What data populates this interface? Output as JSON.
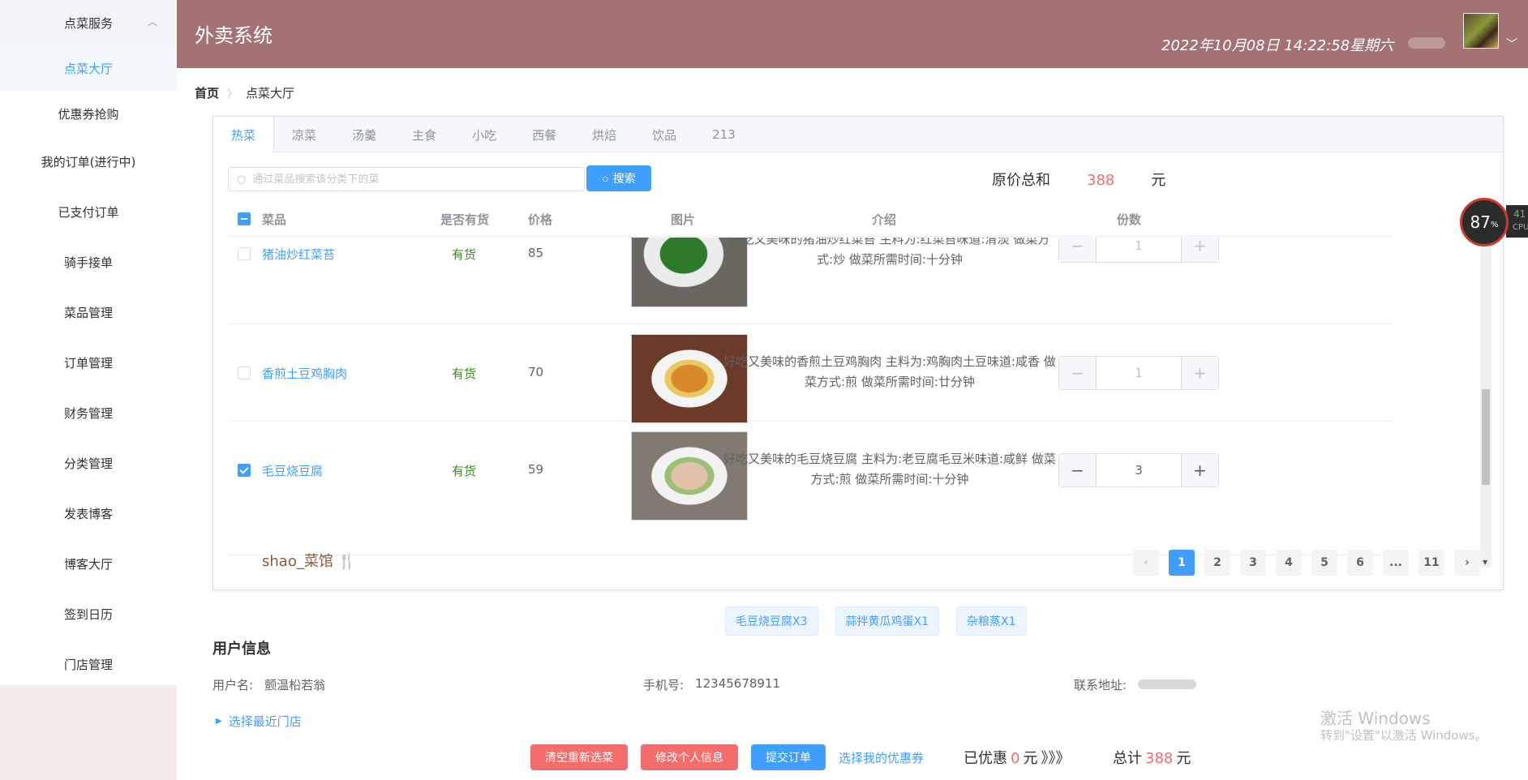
{
  "sidebar": {
    "group_label": "点菜服务",
    "subitems": [
      "点菜大厅",
      "优惠券抢购"
    ],
    "items": [
      "我的订单(进行中)",
      "已支付订单",
      "骑手接单",
      "菜品管理",
      "订单管理",
      "财务管理",
      "分类管理",
      "发表博客",
      "博客大厅",
      "签到日历",
      "门店管理"
    ]
  },
  "header": {
    "title": "外卖系统",
    "datetime": "2022年10月08日 14:22:58星期六"
  },
  "breadcrumb": {
    "home": "首页",
    "current": "点菜大厅"
  },
  "tabs": [
    "热菜",
    "凉菜",
    "汤羹",
    "主食",
    "小吃",
    "西餐",
    "烘焙",
    "饮品",
    "213"
  ],
  "search": {
    "placeholder": "通过菜品搜索该分类下的菜",
    "button": "搜索"
  },
  "summary": {
    "label": "原价总和",
    "amount": "388",
    "unit": "元"
  },
  "table": {
    "columns": [
      "菜品",
      "是否有货",
      "价格",
      "图片",
      "介绍",
      "份数"
    ],
    "rows": [
      {
        "name": "猪油炒红菜苔",
        "stock": "有货",
        "price": "85",
        "intro_line1": "好吃又美味的猪油炒红菜苔 主料为:红菜苔味道:清淡 做菜方",
        "intro_line2": "式:炒 做菜所需时间:十分钟",
        "qty": "1",
        "checked": false
      },
      {
        "name": "香煎土豆鸡胸肉",
        "stock": "有货",
        "price": "70",
        "intro_line1": "好吃又美味的香煎土豆鸡胸肉 主料为:鸡胸肉土豆味道:咸香 做",
        "intro_line2": "菜方式:煎 做菜所需时间:廿分钟",
        "qty": "1",
        "checked": false
      },
      {
        "name": "毛豆烧豆腐",
        "stock": "有货",
        "price": "59",
        "intro_line1": "好吃又美味的毛豆烧豆腐 主料为:老豆腐毛豆米味道:咸鲜 做菜",
        "intro_line2": "方式:煎 做菜所需时间:十分钟",
        "qty": "3",
        "checked": true
      }
    ]
  },
  "shop_name": "shao_菜馆",
  "pagination": {
    "pages": [
      "1",
      "2",
      "3",
      "4",
      "5",
      "6",
      "...",
      "11"
    ],
    "current": "1"
  },
  "chips": [
    "毛豆烧豆腐X3",
    "蒜拌黄瓜鸡蛋X1",
    "杂粮蒸X1"
  ],
  "user_info": {
    "title": "用户信息",
    "username_label": "用户名:",
    "username": "颤温柗若翁",
    "phone_label": "手机号:",
    "phone": "12345678911",
    "address_label": "联系地址:",
    "nearby_link": "选择最近门店"
  },
  "actions": {
    "clear": "清空重新选菜",
    "edit_profile": "修改个人信息",
    "submit": "提交订单",
    "coupon": "选择我的优惠券"
  },
  "discount": {
    "label": "已优惠",
    "amount": "0",
    "unit": "元",
    "arrows": "》》》"
  },
  "total": {
    "label": "总计",
    "amount": "388",
    "unit": "元"
  },
  "watermark": {
    "line1": "激活 Windows",
    "line2": "转到\"设置\"以激活 Windows。"
  },
  "cpu_widget": {
    "percent": "87",
    "pct_sign": "%",
    "side_value": "41",
    "side_label": "CPU"
  },
  "colors": {
    "header_bg": "#a37272",
    "primary": "#409eff",
    "danger": "#f56c6c",
    "sidebar_bottom": "#f6e9e9"
  }
}
